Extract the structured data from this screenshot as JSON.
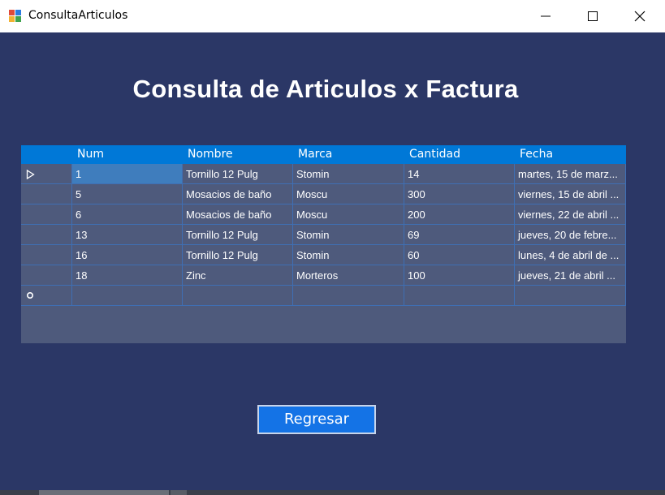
{
  "window": {
    "title": "ConsultaArticulos"
  },
  "heading": "Consulta de Articulos x Factura",
  "grid": {
    "columns": [
      "Num",
      "Nombre",
      "Marca",
      "Cantidad",
      "Fecha"
    ],
    "rows": [
      {
        "num": "1",
        "nombre": "Tornillo 12 Pulg",
        "marca": "Stomin",
        "cantidad": "14",
        "fecha": "martes, 15 de marz..."
      },
      {
        "num": "5",
        "nombre": "Mosacios de baño",
        "marca": "Moscu",
        "cantidad": "300",
        "fecha": "viernes, 15 de abril ..."
      },
      {
        "num": "6",
        "nombre": "Mosacios de baño",
        "marca": "Moscu",
        "cantidad": "200",
        "fecha": "viernes, 22 de abril ..."
      },
      {
        "num": "13",
        "nombre": "Tornillo 12 Pulg",
        "marca": "Stomin",
        "cantidad": "69",
        "fecha": "jueves, 20 de febre..."
      },
      {
        "num": "16",
        "nombre": "Tornillo 12 Pulg",
        "marca": "Stomin",
        "cantidad": "60",
        "fecha": "lunes, 4 de abril de ..."
      },
      {
        "num": "18",
        "nombre": "Zinc",
        "marca": "Morteros",
        "cantidad": "100",
        "fecha": "jueves, 21 de abril ..."
      }
    ]
  },
  "buttons": {
    "regresar": "Regresar"
  },
  "colors": {
    "background": "#2b3766",
    "header": "#0078d7",
    "button": "#1473e6"
  }
}
